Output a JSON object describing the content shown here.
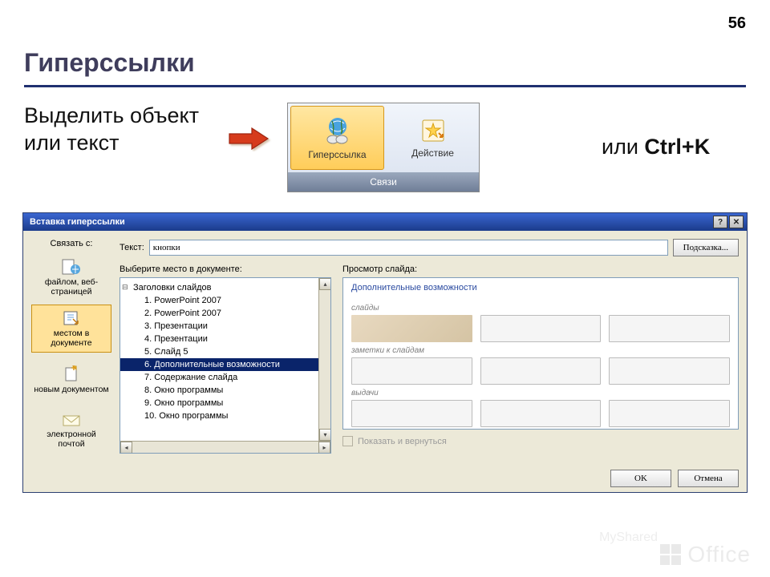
{
  "page_number": "56",
  "slide_title": "Гиперссылки",
  "instruction": "Выделить объект или текст",
  "alt_shortcut_prefix": "или ",
  "alt_shortcut": "Ctrl+K",
  "ribbon": {
    "hyperlink": "Гиперссылка",
    "action": "Действие",
    "group": "Связи"
  },
  "dialog": {
    "title": "Вставка гиперссылки",
    "link_with": "Связать с:",
    "text_label": "Текст:",
    "text_value": "кнопки",
    "tooltip_btn": "Подсказка...",
    "opts": {
      "file": "файлом, веб-страницей",
      "place": "местом в документе",
      "newdoc": "новым документом",
      "email": "электронной почтой"
    },
    "tree_caption": "Выберите место в документе:",
    "tree_root": "Заголовки слайдов",
    "tree_items": [
      "1. PowerPoint 2007",
      "2. PowerPoint 2007",
      "3. Презентации",
      "4. Презентации",
      "5. Слайд 5",
      "6. Дополнительные возможности",
      "7. Содержание слайда",
      "8. Окно программы",
      "9. Окно программы",
      "10. Окно программы"
    ],
    "tree_selected_index": 5,
    "preview_caption": "Просмотр слайда:",
    "preview_title": "Дополнительные возможности",
    "preview_sections": {
      "s1": "слайды",
      "s2": "заметки к слайдам",
      "s3": "выдачи"
    },
    "show_return": "Показать и вернуться",
    "ok": "OK",
    "cancel": "Отмена"
  },
  "footer": {
    "watermark": "MyShared",
    "office": "Office"
  }
}
